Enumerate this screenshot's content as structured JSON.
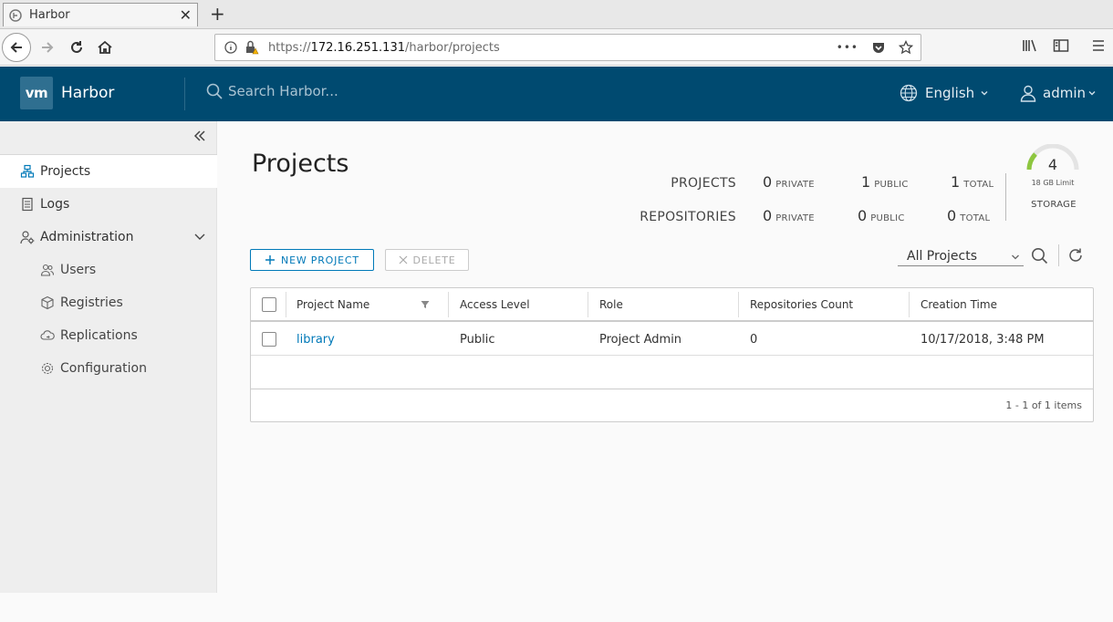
{
  "browser": {
    "tab_title": "Harbor",
    "tab_close": "✕",
    "new_tab": "+",
    "url_scheme": "https://",
    "url_host": "172.16.251.131",
    "url_path": "/harbor/projects",
    "url_more": "•••"
  },
  "header": {
    "logo": "vm",
    "app_name": "Harbor",
    "search_placeholder": "Search Harbor...",
    "language": "English",
    "user": "admin"
  },
  "sidebar": {
    "items": [
      {
        "label": "Projects",
        "icon": "projects-icon",
        "active": true
      },
      {
        "label": "Logs",
        "icon": "logs-icon"
      },
      {
        "label": "Administration",
        "icon": "administration-icon"
      }
    ],
    "admin_items": [
      {
        "label": "Users",
        "icon": "users-icon"
      },
      {
        "label": "Registries",
        "icon": "registries-icon"
      },
      {
        "label": "Replications",
        "icon": "replications-icon"
      },
      {
        "label": "Configuration",
        "icon": "configuration-icon"
      }
    ]
  },
  "main": {
    "title": "Projects",
    "stats": {
      "projects_label": "PROJECTS",
      "repositories_label": "REPOSITORIES",
      "private_label": "PRIVATE",
      "public_label": "PUBLIC",
      "total_label": "TOTAL",
      "projects": {
        "private": "0",
        "public": "1",
        "total": "1"
      },
      "repositories": {
        "private": "0",
        "public": "0",
        "total": "0"
      }
    },
    "storage": {
      "value": "4",
      "limit": "18 GB Limit",
      "label": "STORAGE"
    },
    "new_project_label": "NEW PROJECT",
    "delete_label": "DELETE",
    "filter_value": "All Projects"
  },
  "table": {
    "columns": [
      "Project Name",
      "Access Level",
      "Role",
      "Repositories Count",
      "Creation Time"
    ],
    "rows": [
      {
        "name": "library",
        "access": "Public",
        "role": "Project Admin",
        "repos": "0",
        "created": "10/17/2018, 3:48 PM"
      }
    ],
    "footer": "1 - 1 of 1 items"
  },
  "colors": {
    "header_bg": "#004a70",
    "link": "#0079b8",
    "gauge": "#8dc63f"
  }
}
